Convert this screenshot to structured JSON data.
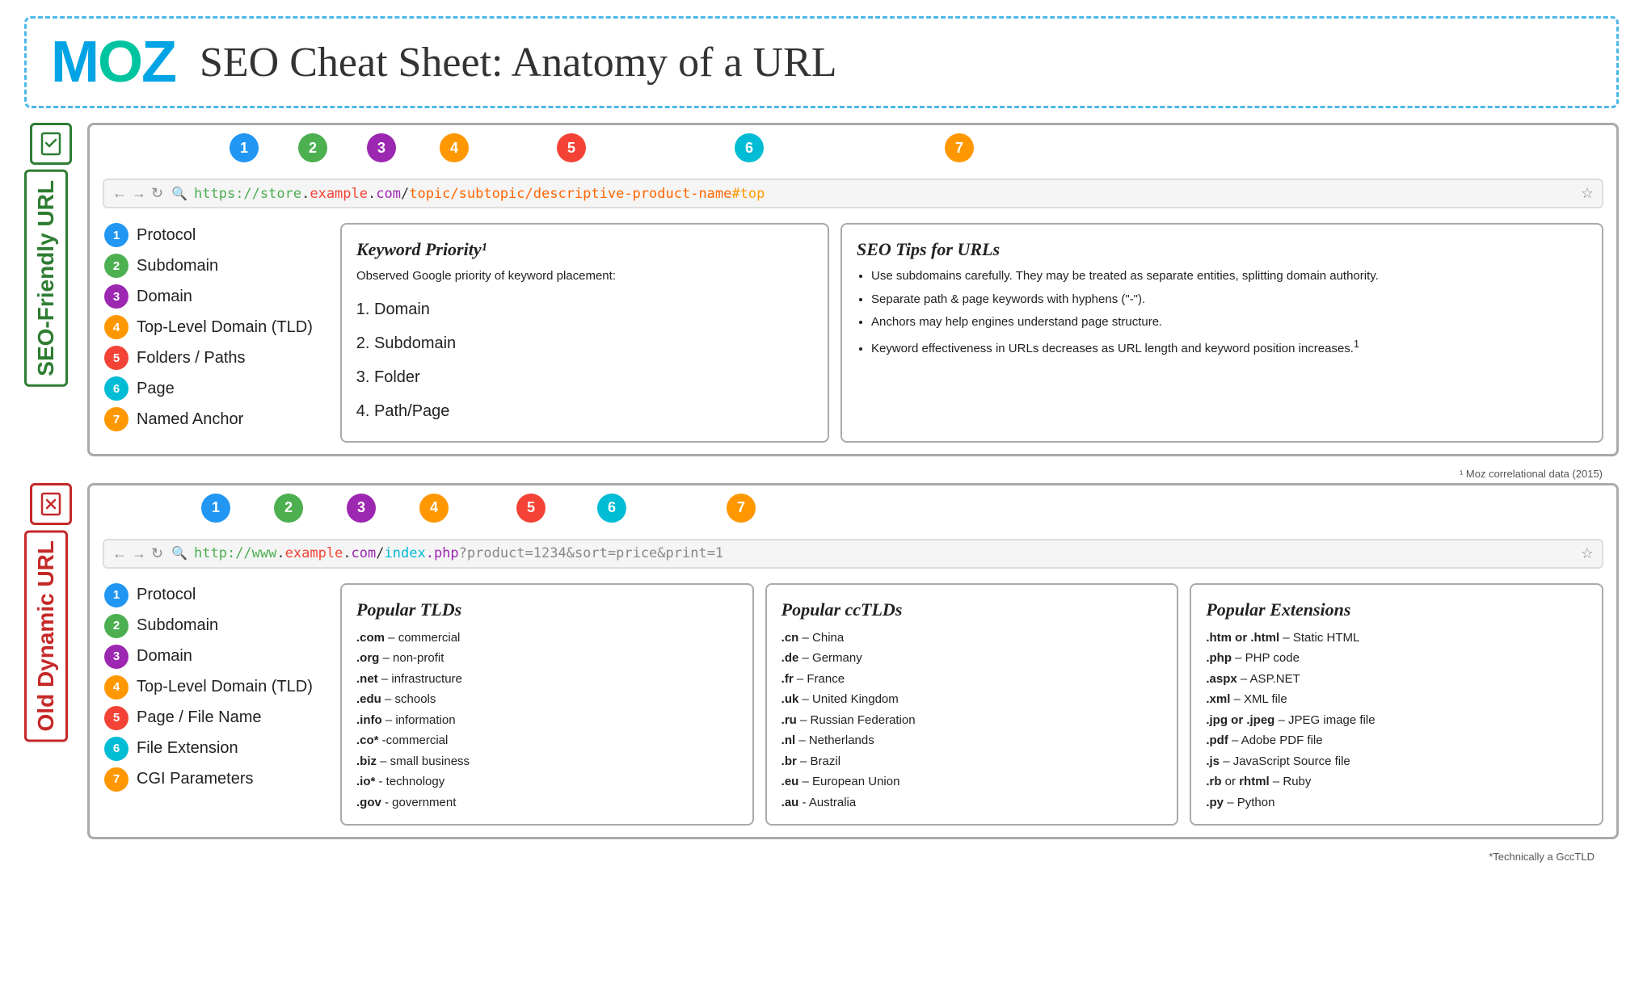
{
  "header": {
    "logo": "MOZ",
    "title": "SEO Cheat Sheet: Anatomy of a URL"
  },
  "seo_section": {
    "label": "SEO-Friendly URL",
    "url_display": "https://store.example.com/topic/subtopic/descriptive-product-name#top",
    "parts": [
      {
        "num": "1",
        "label": "Protocol",
        "color": "c1"
      },
      {
        "num": "2",
        "label": "Subdomain",
        "color": "c2"
      },
      {
        "num": "3",
        "label": "Domain",
        "color": "c3"
      },
      {
        "num": "4",
        "label": "Top-Level Domain (TLD)",
        "color": "c4"
      },
      {
        "num": "5",
        "label": "Folders / Paths",
        "color": "c5"
      },
      {
        "num": "6",
        "label": "Page",
        "color": "c6"
      },
      {
        "num": "7",
        "label": "Named Anchor",
        "color": "c7"
      }
    ],
    "keyword_priority": {
      "title": "Keyword Priority¹",
      "subtitle": "Observed Google priority of keyword placement:",
      "items": [
        "Domain",
        "Subdomain",
        "Folder",
        "Path/Page"
      ]
    },
    "seo_tips": {
      "title": "SEO Tips for URLs",
      "tips": [
        "Use subdomains carefully. They may be treated as separate entities, splitting domain authority.",
        "Separate path & page keywords with hyphens (\"-\").",
        "Anchors may help engines understand page structure.",
        "Keyword effectiveness in URLs decreases as URL length and keyword position increases.¹"
      ]
    }
  },
  "dynamic_section": {
    "label": "Old Dynamic URL",
    "url_display": "http://www.example.com/index.php?product=1234&sort=price&print=1",
    "parts": [
      {
        "num": "1",
        "label": "Protocol",
        "color": "c1"
      },
      {
        "num": "2",
        "label": "Subdomain",
        "color": "c2"
      },
      {
        "num": "3",
        "label": "Domain",
        "color": "c3"
      },
      {
        "num": "4",
        "label": "Top-Level Domain (TLD)",
        "color": "c4"
      },
      {
        "num": "5",
        "label": "Page / File Name",
        "color": "c5"
      },
      {
        "num": "6",
        "label": "File Extension",
        "color": "c6"
      },
      {
        "num": "7",
        "label": "CGI Parameters",
        "color": "c7"
      }
    ],
    "popular_tlds": {
      "title": "Popular TLDs",
      "items": [
        ".com – commercial",
        ".org – non-profit",
        ".net – infrastructure",
        ".edu – schools",
        ".info – information",
        ".co* -commercial",
        ".biz – small business",
        ".io* - technology",
        ".gov - government"
      ]
    },
    "popular_cctlds": {
      "title": "Popular ccTLDs",
      "items": [
        ".cn – China",
        ".de – Germany",
        ".fr – France",
        ".uk – United Kingdom",
        ".ru – Russian Federation",
        ".nl – Netherlands",
        ".br – Brazil",
        ".eu – European Union",
        ".au - Australia"
      ]
    },
    "popular_extensions": {
      "title": "Popular Extensions",
      "items": [
        ".htm or .html – Static HTML",
        ".php – PHP code",
        ".aspx – ASP.NET",
        ".xml – XML file",
        ".jpg or .jpeg – JPEG image file",
        ".pdf – Adobe PDF file",
        ".js – JavaScript Source file",
        ".rb or rhtml – Ruby",
        ".py – Python"
      ]
    }
  },
  "footnotes": {
    "note1": "¹ Moz correlational data (2015)",
    "note2": "*Technically a GccTLD"
  }
}
